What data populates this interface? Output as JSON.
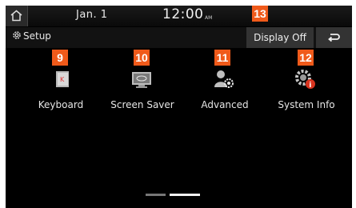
{
  "statusbar": {
    "date": "Jan.  1",
    "time": "12:00",
    "ampm": "AM"
  },
  "titlebar": {
    "title": "Setup",
    "display_off_label": "Display Off"
  },
  "badges": {
    "b13": "13",
    "b9": "9",
    "b10": "10",
    "b11": "11",
    "b12": "12"
  },
  "tiles": [
    {
      "label": "Keyboard",
      "icon": "keyboard-icon"
    },
    {
      "label": "Screen Saver",
      "icon": "screen-saver-icon"
    },
    {
      "label": "Advanced",
      "icon": "advanced-icon"
    },
    {
      "label": "System Info",
      "icon": "system-info-icon"
    }
  ],
  "page_indicator": {
    "pages": 2,
    "current": 2
  },
  "colors": {
    "badge": "#f05a1a",
    "background": "#000000"
  }
}
